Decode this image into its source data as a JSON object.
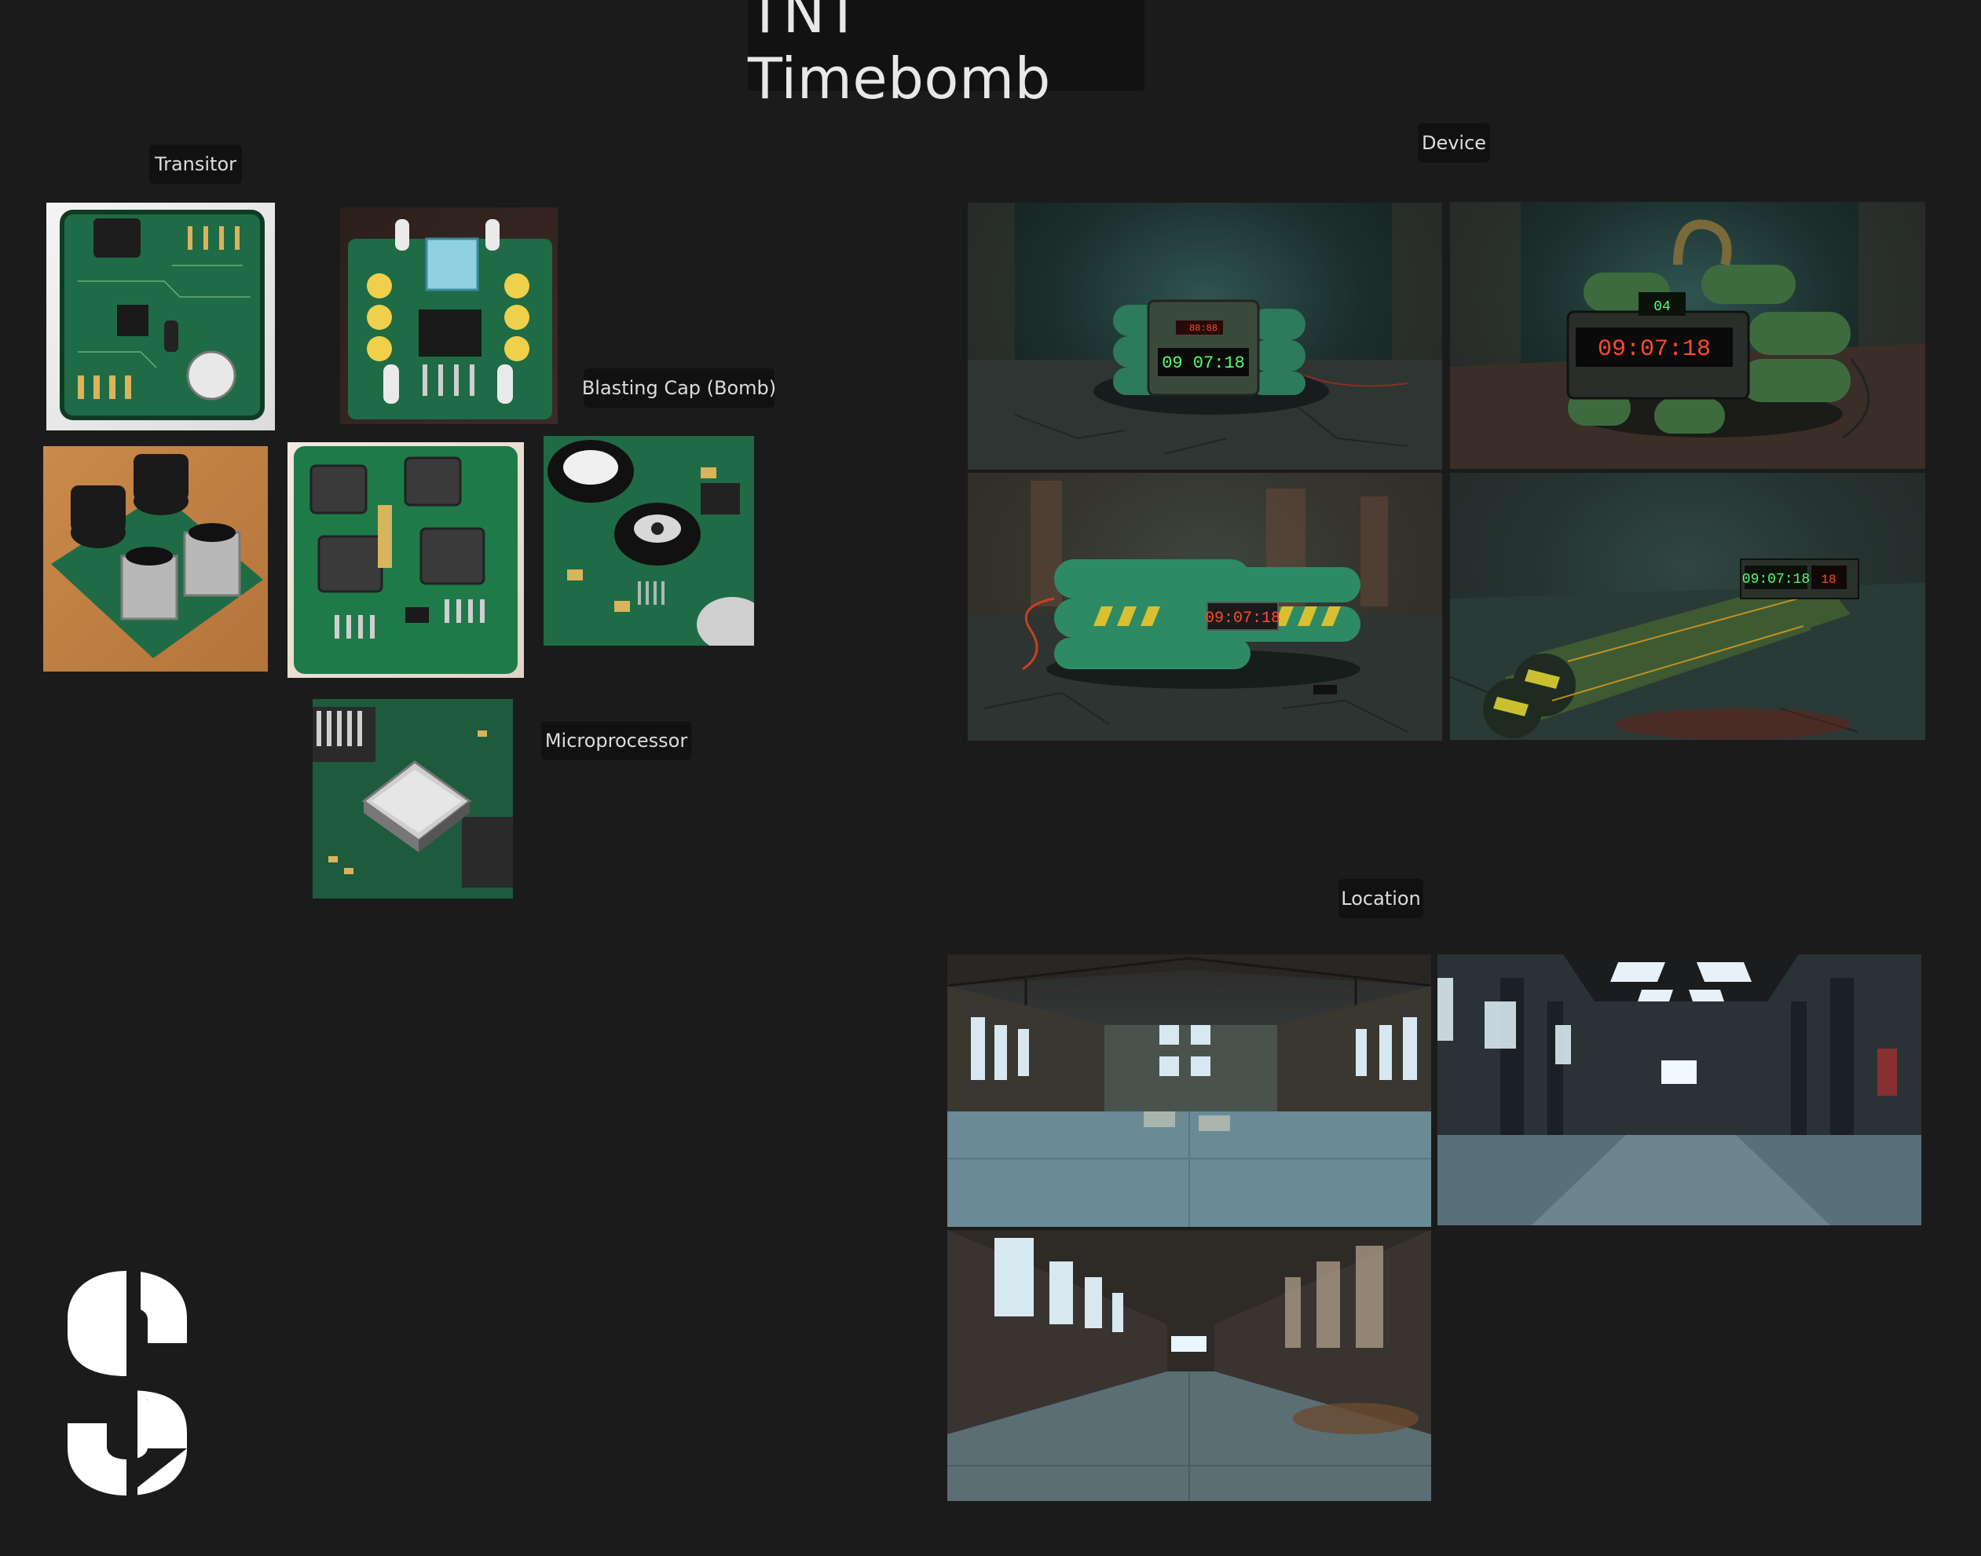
{
  "board": {
    "title": "TNT Timebomb",
    "labels": {
      "transitor": "Transitor",
      "blasting_cap": "Blasting Cap (Bomb)",
      "microprocessor": "Microprocessor",
      "device": "Device",
      "location": "Location"
    }
  },
  "device_timers": [
    "09 07:18",
    "09:07:18",
    "09:07:18",
    "09:07:18"
  ],
  "colors": {
    "background": "#1b1b1b",
    "label_bg": "#111111",
    "pcb_green": "#1f6b45",
    "timer_red": "#ff4a2e",
    "timer_green": "#59ff6b",
    "logo": "#ffffff"
  },
  "icons": {
    "logo": "stencil-s-logo"
  }
}
